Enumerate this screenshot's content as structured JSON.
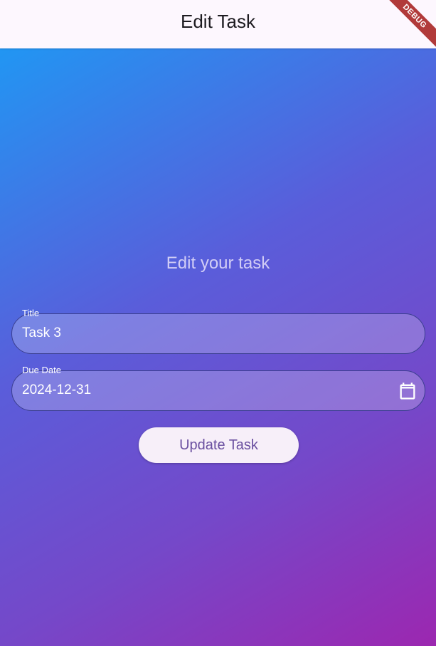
{
  "appbar": {
    "title": "Edit Task"
  },
  "debug_banner": {
    "label": "DEBUG"
  },
  "form": {
    "heading": "Edit your task",
    "title_field": {
      "label": "Title",
      "value": "Task 3"
    },
    "due_date_field": {
      "label": "Due Date",
      "value": "2024-12-31",
      "icon": "calendar-icon"
    },
    "update_button_label": "Update Task"
  },
  "colors": {
    "gradient_start": "#2196F3",
    "gradient_end": "#9C27B0",
    "appbar_bg": "#FDF7FE",
    "button_bg": "#F7EFF9",
    "button_text": "#6A4FA0",
    "debug_ribbon": "#B13A3A"
  }
}
